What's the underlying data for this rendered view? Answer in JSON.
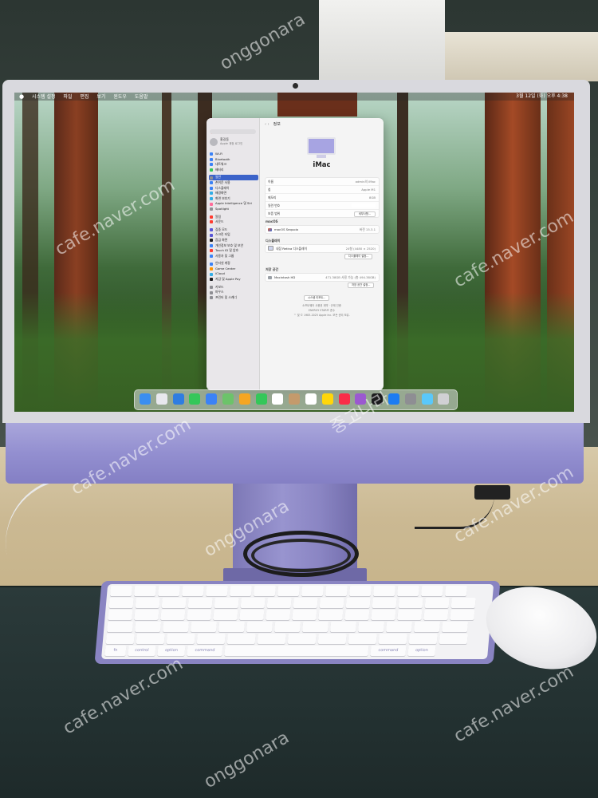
{
  "desktop": {
    "menubar": {
      "apple": "",
      "items": [
        "시스템 설정",
        "파일",
        "편집",
        "보기",
        "윈도우",
        "도움말"
      ],
      "clock": "3월 12일 (화) 오후 4:38"
    },
    "settings_window": {
      "sidebar": {
        "account_name": "홍길동",
        "account_sub": "Apple 계정 로그인",
        "items": [
          {
            "label": "Wi-Fi",
            "color": "#3b82f6"
          },
          {
            "label": "Bluetooth",
            "color": "#3b82f6"
          },
          {
            "label": "네트워크",
            "color": "#3b82f6"
          },
          {
            "label": "배터리",
            "color": "#34c759"
          },
          {
            "label": "일반",
            "color": "#8e8e93",
            "selected": true
          },
          {
            "label": "손쉬운 사용",
            "color": "#3b82f6"
          },
          {
            "label": "디스플레이",
            "color": "#3b82f6"
          },
          {
            "label": "배경화면",
            "color": "#32ade6"
          },
          {
            "label": "화면 보호기",
            "color": "#32ade6"
          },
          {
            "label": "Apple Intelligence 및 Siri",
            "color": "#ff6b9a"
          },
          {
            "label": "Spotlight",
            "color": "#8e8e93"
          },
          {
            "label": "알림",
            "color": "#ff3b30"
          },
          {
            "label": "사운드",
            "color": "#ff3b30"
          },
          {
            "label": "집중 모드",
            "color": "#5856d6"
          },
          {
            "label": "스크린 타임",
            "color": "#5856d6"
          },
          {
            "label": "잠금 화면",
            "color": "#1c1c1e"
          },
          {
            "label": "개인정보 보호 및 보안",
            "color": "#3b82f6"
          },
          {
            "label": "Touch ID 및 암호",
            "color": "#ff3b30"
          },
          {
            "label": "사용자 및 그룹",
            "color": "#3b82f6"
          },
          {
            "label": "인터넷 계정",
            "color": "#3b82f6"
          },
          {
            "label": "Game Center",
            "color": "#ff9500"
          },
          {
            "label": "iCloud",
            "color": "#32ade6"
          },
          {
            "label": "지갑 및 Apple Pay",
            "color": "#1c1c1e"
          },
          {
            "label": "키보드",
            "color": "#8e8e93"
          },
          {
            "label": "마우스",
            "color": "#8e8e93"
          },
          {
            "label": "프린터 및 스캐너",
            "color": "#8e8e93"
          }
        ]
      },
      "main": {
        "nav_title": "정보",
        "device_name": "iMac",
        "info_rows": [
          {
            "label": "이름",
            "value": "admin의 iMac"
          },
          {
            "label": "칩",
            "value": "Apple M1"
          },
          {
            "label": "메모리",
            "value": "8GB"
          },
          {
            "label": "일련 번호",
            "value": ""
          },
          {
            "label": "보증 범위",
            "value": "세부사항..."
          }
        ],
        "macos_label": "macOS",
        "macos_name": "macOS Sequoia",
        "macos_version": "버전 15.3.1",
        "displays_label": "디스플레이",
        "display_name": "내장 Retina 디스플레이",
        "display_size": "24형 (4480 × 2520)",
        "display_button": "디스플레이 설정...",
        "storage_label": "저장 공간",
        "storage_name": "Macintosh HD",
        "storage_value": "471.38GB 사용 가능 (총 494.38GB)",
        "storage_button": "저장 공간 설정...",
        "report_button": "시스템 리포트...",
        "footer_1": "소프트웨어 사용권 계약 · 규제 인증",
        "footer_2": "ENERGY STAR® 준수",
        "footer_3": "™ 및 © 1983-2025 Apple Inc. 모든 권리 보유."
      }
    },
    "dock_icons": [
      "finder-icon",
      "launchpad-icon",
      "safari-icon",
      "messages-icon",
      "mail-icon",
      "maps-icon",
      "photos-icon",
      "facetime-icon",
      "calendar-icon",
      "contacts-icon",
      "reminders-icon",
      "notes-icon",
      "music-icon",
      "podcasts-icon",
      "apple-tv-icon",
      "app-store-icon",
      "system-settings-icon",
      "downloads-icon",
      "trash-icon"
    ]
  },
  "keyboard": {
    "row_bottom": [
      "fn",
      "control",
      "option",
      "command",
      "",
      "command",
      "option"
    ]
  },
  "watermarks": [
    "cafe.naver.com",
    "onggonara",
    "중고나라"
  ]
}
